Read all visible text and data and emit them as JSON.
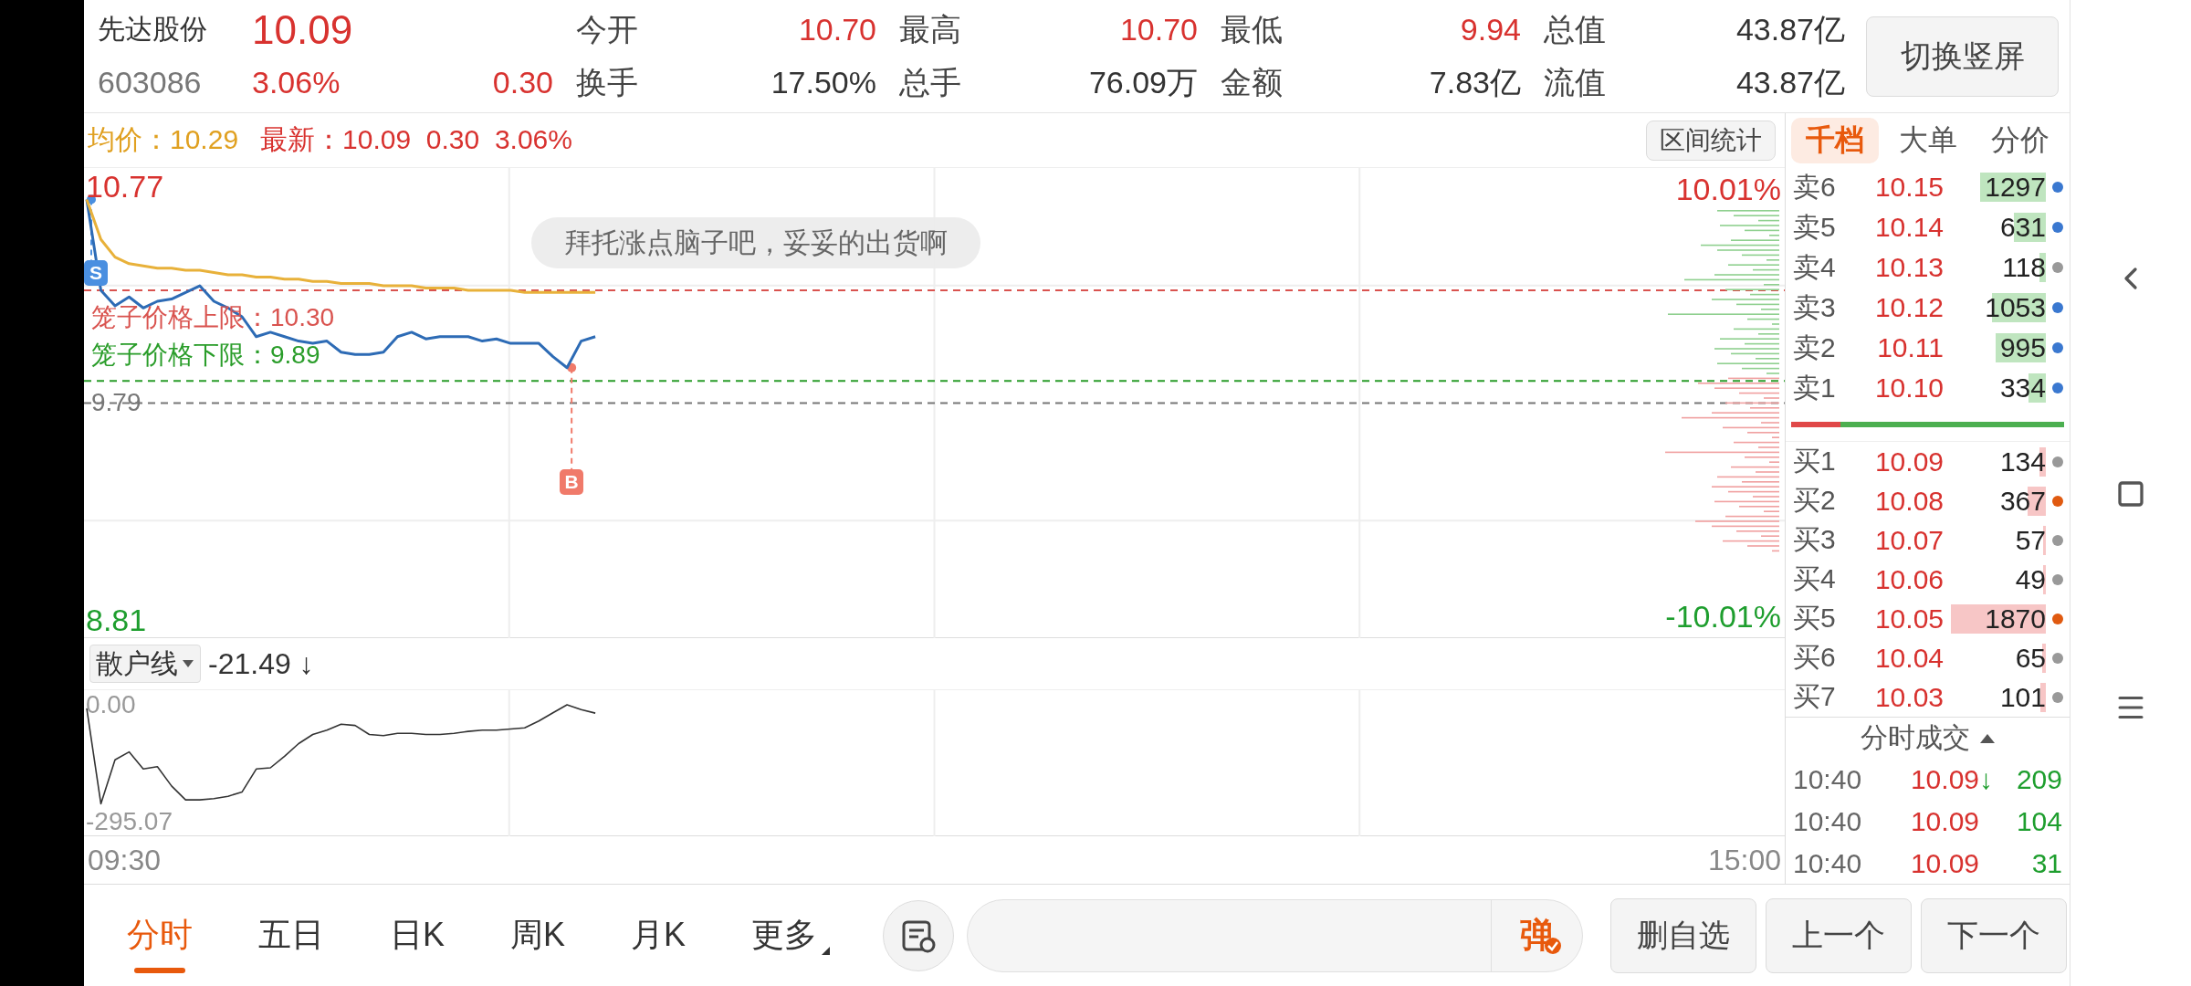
{
  "quote": {
    "name": "先达股份",
    "price": "10.09",
    "code": "603086",
    "change_pct": "3.06%",
    "change": "0.30",
    "stats": [
      {
        "label": "今开",
        "value": "10.70",
        "color": "#d8322f"
      },
      {
        "label": "最高",
        "value": "10.70",
        "color": "#d8322f"
      },
      {
        "label": "最低",
        "value": "9.94",
        "color": "#d8322f"
      },
      {
        "label": "总值",
        "value": "43.87亿",
        "color": "#333333"
      },
      {
        "label": "换手",
        "value": "17.50%",
        "color": "#333333"
      },
      {
        "label": "总手",
        "value": "76.09万",
        "color": "#333333"
      },
      {
        "label": "金额",
        "value": "7.83亿",
        "color": "#333333"
      },
      {
        "label": "流值",
        "value": "43.87亿",
        "color": "#333333"
      }
    ]
  },
  "orientation_button": "切换竖屏",
  "chart_legend": {
    "average": "均价：10.29",
    "latest": "最新：10.09  0.30  3.06%"
  },
  "range_stats_button": "区间统计",
  "main_chart": {
    "top_pct": "10.01%",
    "bottom_pct": "-10.01%",
    "comment": "拜托涨点脑子吧，妥妥的出货啊",
    "chart_data": {
      "type": "line",
      "categories": [
        null,
        null,
        null,
        null,
        null,
        null,
        null,
        null,
        null,
        null,
        null,
        null,
        null,
        null,
        null,
        null,
        null,
        null,
        null,
        null,
        null,
        null,
        null,
        null,
        null,
        null,
        null,
        null,
        null,
        null,
        null,
        null,
        null,
        null,
        null,
        null,
        null,
        null,
        null,
        null,
        null,
        null,
        null,
        null,
        null,
        null,
        null,
        null,
        null,
        null,
        null,
        null,
        null,
        null,
        null,
        null,
        null,
        null,
        null,
        null,
        null,
        null,
        null,
        null,
        null,
        null,
        null,
        null,
        null,
        null,
        null,
        null,
        null,
        null,
        null,
        null,
        null,
        null,
        null,
        null,
        null,
        null,
        null,
        null,
        null,
        null,
        null,
        null,
        null,
        null,
        null,
        null,
        null,
        null,
        null,
        null,
        null,
        null,
        null,
        null,
        null,
        null,
        null,
        null,
        null,
        null,
        null,
        null,
        null,
        null,
        null,
        null,
        null,
        null,
        null,
        null,
        null,
        null,
        null,
        null,
        null
      ],
      "ylim": [
        8.81,
        10.77
      ],
      "yticks": [
        {
          "value": 10.77,
          "label": "10.77"
        },
        {
          "value": 8.81,
          "label": "8.81"
        }
      ],
      "series": [
        {
          "color": "#2d6bb5",
          "values": [
            10.71,
            10.3,
            10.23,
            10.27,
            10.22,
            10.25,
            10.26,
            10.29,
            10.32,
            10.25,
            10.22,
            10.18,
            10.09,
            10.11,
            10.09,
            10.07,
            10.06,
            10.07,
            10.02,
            10.01,
            10.01,
            10.02,
            10.09,
            10.11,
            10.08,
            10.09,
            10.09,
            10.09,
            10.07,
            10.08,
            10.06,
            10.06,
            10.06,
            10.0,
            9.95,
            10.07,
            10.09,
            null,
            null,
            null,
            null,
            null,
            null,
            null,
            null,
            null,
            null,
            null,
            null,
            null,
            null,
            null,
            null,
            null,
            null,
            null,
            null,
            null,
            null,
            null,
            null,
            null,
            null,
            null,
            null,
            null,
            null,
            null,
            null,
            null,
            null,
            null,
            null,
            null,
            null,
            null,
            null,
            null,
            null,
            null,
            null,
            null,
            null,
            null,
            null,
            null,
            null,
            null,
            null,
            null,
            null,
            null,
            null,
            null,
            null,
            null,
            null,
            null,
            null,
            null,
            null,
            null,
            null,
            null,
            null,
            null,
            null,
            null,
            null,
            null,
            null,
            null,
            null,
            null,
            null,
            null,
            null,
            null,
            null,
            null,
            null
          ]
        },
        {
          "color": "#e8b13a",
          "values": [
            10.71,
            10.53,
            10.45,
            10.42,
            10.41,
            10.4,
            10.4,
            10.39,
            10.39,
            10.38,
            10.37,
            10.37,
            10.36,
            10.36,
            10.35,
            10.35,
            10.34,
            10.34,
            10.33,
            10.33,
            10.33,
            10.32,
            10.32,
            10.32,
            10.31,
            10.31,
            10.31,
            10.3,
            10.3,
            10.3,
            10.3,
            10.29,
            10.29,
            10.29,
            10.29,
            10.29,
            10.29,
            null,
            null,
            null,
            null,
            null,
            null,
            null,
            null,
            null,
            null,
            null,
            null,
            null,
            null,
            null,
            null,
            null,
            null,
            null,
            null,
            null,
            null,
            null,
            null,
            null,
            null,
            null,
            null,
            null,
            null,
            null,
            null,
            null,
            null,
            null,
            null,
            null,
            null,
            null,
            null,
            null,
            null,
            null,
            null,
            null,
            null,
            null,
            null,
            null,
            null,
            null,
            null,
            null,
            null,
            null,
            null,
            null,
            null,
            null,
            null,
            null,
            null,
            null,
            null,
            null,
            null,
            null,
            null,
            null,
            null,
            null,
            null,
            null,
            null,
            null,
            null,
            null,
            null,
            null,
            null,
            null,
            null,
            null,
            null
          ]
        }
      ],
      "ref_lines": [
        {
          "axis": "y",
          "value": 10.3,
          "label": "笼子价格上限：10.30",
          "color": "#d9534f"
        },
        {
          "axis": "y",
          "value": 9.89,
          "label": "笼子价格下限：9.89",
          "color": "#2a9d2a"
        },
        {
          "axis": "y",
          "value": 9.79,
          "label": "9.79",
          "color": "#777777"
        }
      ],
      "annotations": [
        {
          "y": 10.71,
          "text": "S"
        },
        {
          "y": 9.95,
          "text": "B"
        }
      ]
    }
  },
  "sub_chart": {
    "indicator": "散户线",
    "reading": "-21.49 ↓",
    "chart_data": {
      "type": "line",
      "categories": [
        null,
        null,
        null,
        null,
        null,
        null,
        null,
        null,
        null,
        null,
        null,
        null,
        null,
        null,
        null,
        null,
        null,
        null,
        null,
        null,
        null,
        null,
        null,
        null,
        null,
        null,
        null,
        null,
        null,
        null,
        null,
        null,
        null,
        null,
        null,
        null,
        null,
        null,
        null,
        null,
        null,
        null,
        null,
        null,
        null,
        null,
        null,
        null,
        null,
        null,
        null,
        null,
        null,
        null,
        null,
        null,
        null,
        null,
        null,
        null,
        null,
        null,
        null,
        null,
        null,
        null,
        null,
        null,
        null,
        null,
        null,
        null,
        null,
        null,
        null,
        null,
        null,
        null,
        null,
        null,
        null,
        null,
        null,
        null,
        null,
        null,
        null,
        null,
        null,
        null,
        null,
        null,
        null,
        null,
        null,
        null,
        null,
        null,
        null,
        null,
        null,
        null,
        null,
        null,
        null,
        null,
        null,
        null,
        null,
        null,
        null,
        null,
        null,
        null,
        null,
        null,
        null,
        null,
        null,
        null,
        null
      ],
      "ylim": [
        -295.07,
        0
      ],
      "yticks": [
        {
          "value": 0,
          "label": "0.00"
        },
        {
          "value": -295.07,
          "label": "-295.07"
        }
      ],
      "series": [
        {
          "color": "#333333",
          "values": [
            -9,
            -250,
            -139,
            -119,
            -162,
            -156,
            -205,
            -240,
            -240,
            -237,
            -231,
            -220,
            -162,
            -159,
            -130,
            -98,
            -75,
            -64,
            -49,
            -52,
            -75,
            -78,
            -72,
            -72,
            -75,
            -75,
            -72,
            -67,
            -64,
            -64,
            -61,
            -58,
            -41,
            -20,
            0,
            -12,
            -21,
            null,
            null,
            null,
            null,
            null,
            null,
            null,
            null,
            null,
            null,
            null,
            null,
            null,
            null,
            null,
            null,
            null,
            null,
            null,
            null,
            null,
            null,
            null,
            null,
            null,
            null,
            null,
            null,
            null,
            null,
            null,
            null,
            null,
            null,
            null,
            null,
            null,
            null,
            null,
            null,
            null,
            null,
            null,
            null,
            null,
            null,
            null,
            null,
            null,
            null,
            null,
            null,
            null,
            null,
            null,
            null,
            null,
            null,
            null,
            null,
            null,
            null,
            null,
            null,
            null,
            null,
            null,
            null,
            null,
            null,
            null,
            null,
            null,
            null,
            null,
            null,
            null,
            null,
            null,
            null,
            null,
            null,
            null,
            null
          ]
        }
      ]
    },
    "time_axis": [
      "09:30",
      "15:00"
    ]
  },
  "order_book": {
    "tabs": [
      {
        "label": "千档",
        "selected": true
      },
      {
        "label": "大单",
        "selected": false
      },
      {
        "label": "分价",
        "selected": false
      }
    ],
    "asks": [
      {
        "label": "卖6",
        "price": "10.15",
        "volume": "1297",
        "color": "#3a78d0"
      },
      {
        "label": "卖5",
        "price": "10.14",
        "volume": "631",
        "color": "#3a78d0"
      },
      {
        "label": "卖4",
        "price": "10.13",
        "volume": "118",
        "color": "#999999"
      },
      {
        "label": "卖3",
        "price": "10.12",
        "volume": "1053",
        "color": "#3a78d0"
      },
      {
        "label": "卖2",
        "price": "10.11",
        "volume": "995",
        "color": "#3a78d0"
      },
      {
        "label": "卖1",
        "price": "10.10",
        "volume": "334",
        "color": "#3a78d0"
      }
    ],
    "ratio_bar": {
      "level": 0.18
    },
    "bids": [
      {
        "label": "买1",
        "price": "10.09",
        "volume": "134",
        "color": "#999999"
      },
      {
        "label": "买2",
        "price": "10.08",
        "volume": "367",
        "color": "#e05a10"
      },
      {
        "label": "买3",
        "price": "10.07",
        "volume": "57",
        "color": "#999999"
      },
      {
        "label": "买4",
        "price": "10.06",
        "volume": "49",
        "color": "#999999"
      },
      {
        "label": "买5",
        "price": "10.05",
        "volume": "1870",
        "color": "#e05a10"
      },
      {
        "label": "买6",
        "price": "10.04",
        "volume": "65",
        "color": "#999999"
      },
      {
        "label": "买7",
        "price": "10.03",
        "volume": "101",
        "color": "#999999"
      }
    ]
  },
  "trades": {
    "title": "分时成交",
    "rows": [
      {
        "time": "10:40",
        "price": "10.09",
        "arrow": "↓",
        "volume": "209"
      },
      {
        "time": "10:40",
        "price": "10.09",
        "volume": "104"
      },
      {
        "time": "10:40",
        "price": "10.09",
        "volume": "31"
      }
    ]
  },
  "bottom_bar": {
    "period_tabs": [
      {
        "label": "分时",
        "selected": true,
        "has_menu": false
      },
      {
        "label": "五日",
        "selected": false,
        "has_menu": false
      },
      {
        "label": "日K",
        "selected": false,
        "has_menu": false
      },
      {
        "label": "周K",
        "selected": false,
        "has_menu": false
      },
      {
        "label": "月K",
        "selected": false,
        "has_menu": false
      },
      {
        "label": "更多",
        "selected": false,
        "has_menu": true
      }
    ],
    "danmaku_button": "弹",
    "actions": [
      "删自选",
      "上一个",
      "下一个"
    ]
  }
}
